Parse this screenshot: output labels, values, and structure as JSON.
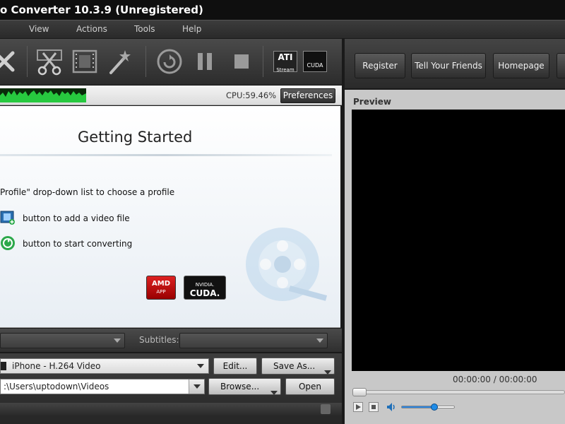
{
  "window": {
    "title": "o Converter 10.3.9 (Unregistered)"
  },
  "menu": [
    "View",
    "Actions",
    "Tools",
    "Help"
  ],
  "toolbar": {
    "icons": [
      "cancel-icon",
      "cut-icon",
      "film-icon",
      "magic-wand-icon",
      "convert-icon",
      "pause-icon",
      "stop-icon",
      "ati-stream-icon",
      "cuda-icon"
    ],
    "ati_label": "ATI",
    "ati_sub": "Stream",
    "cuda_label": "CUDA"
  },
  "top_buttons": [
    "Register",
    "Tell Your Friends",
    "Homepage"
  ],
  "status": {
    "cpu": "CPU:59.46%",
    "preferences": "Preferences"
  },
  "getting_started": {
    "title": "Getting Started",
    "steps": [
      "Profile\" drop-down list to choose a profile",
      "button to add a video file",
      "button to start converting"
    ],
    "badges": {
      "amd": "AMD",
      "amd_sub": "APP",
      "nvidia": "NVIDIA.",
      "cuda": "CUDA."
    }
  },
  "subtitles": {
    "label": "Subtitles:"
  },
  "profile": {
    "value": "iPhone - H.264 Video",
    "edit": "Edit...",
    "save_as": "Save As..."
  },
  "destination": {
    "path": ":\\Users\\uptodown\\Videos",
    "browse": "Browse...",
    "open": "Open"
  },
  "preview": {
    "label": "Preview",
    "time": "00:00:00 / 00:00:00",
    "volume": 0.62
  },
  "colors": {
    "accent_green": "#27c93f",
    "panel_dark": "#2e2e2e"
  }
}
